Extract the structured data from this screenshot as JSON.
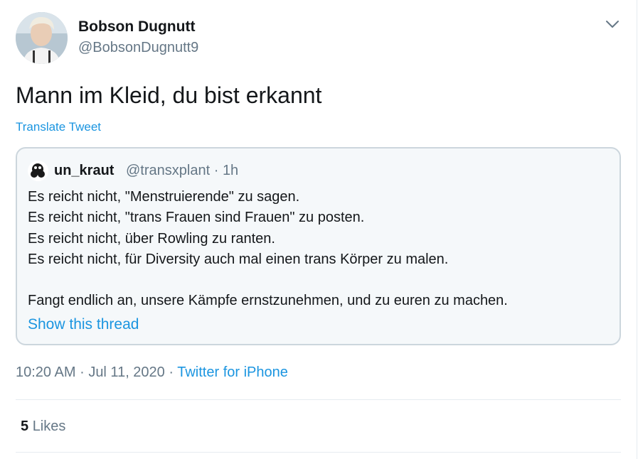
{
  "author": {
    "name": "Bobson Dugnutt",
    "handle": "@BobsonDugnutt9"
  },
  "tweet": {
    "text": "Mann im Kleid, du bist erkannt",
    "translate_label": "Translate Tweet"
  },
  "quoted_tweet": {
    "name": "un_kraut",
    "handle": "@transxplant",
    "time": "1h",
    "lines": [
      "Es reicht nicht, \"Menstruierende\" zu sagen.",
      "Es reicht nicht, \"trans Frauen sind Frauen\" zu posten.",
      "Es reicht nicht, über Rowling zu ranten.",
      "Es reicht nicht, für Diversity auch mal einen trans Körper zu malen.",
      "",
      "Fangt endlich an, unsere Kämpfe ernstzunehmen, und zu euren zu machen."
    ],
    "show_thread_label": "Show this thread"
  },
  "meta": {
    "time": "10:20 AM",
    "date": "Jul 11, 2020",
    "separator": "·",
    "source": "Twitter for iPhone"
  },
  "stats": {
    "likes_count": "5",
    "likes_label": "Likes"
  },
  "icons": {
    "caret": "chevron-down-icon"
  },
  "colors": {
    "link": "#1b95e0",
    "secondary_text": "#657786",
    "primary_text": "#14171a",
    "border": "#ccd6dd",
    "quote_bg": "#f5f8fa"
  }
}
